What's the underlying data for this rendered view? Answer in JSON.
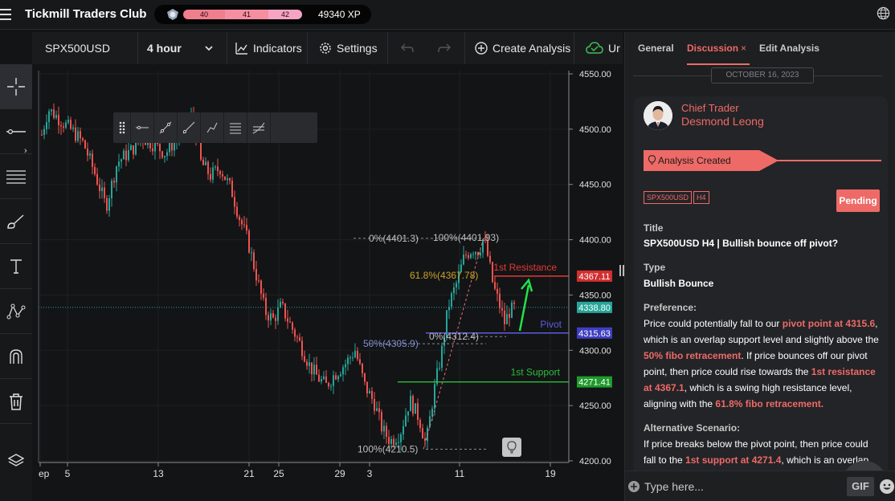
{
  "app": {
    "brand": "Tickmill Traders Club"
  },
  "xp": {
    "levels": [
      "40",
      "41",
      "42"
    ],
    "progress": 0.88,
    "total": "49340 XP"
  },
  "toolbar": {
    "symbol": "SPX500USD",
    "interval": "4 hour",
    "indicators": "Indicators",
    "settings": "Settings",
    "create_analysis": "Create Analysis",
    "extra": "Ur"
  },
  "chart": {
    "y_ticks": [
      "4550.00",
      "4500.00",
      "4450.00",
      "4400.00",
      "4350.00",
      "4300.00",
      "4250.00",
      "4200.00"
    ],
    "x_ticks": [
      "ep",
      "5",
      "13",
      "21",
      "25",
      "29",
      "3",
      "11",
      "19"
    ],
    "fib_labels": {
      "top_left": "0%(4401.3)",
      "top_right": "100%(4401.93)",
      "fib618": "61.8%(4367.78)",
      "fib50": "50%(4305.9)",
      "fib0": "0%(4312.4)",
      "fib100": "100%(4210.5)"
    },
    "levels": {
      "resistance_label": "1st Resistance",
      "resistance_value": "4367.11",
      "current_value": "4338.80",
      "pivot_label": "Pivot",
      "pivot_value": "4315.63",
      "support_label": "1st Support",
      "support_value": "4271.41"
    },
    "colors": {
      "up": "#26a69a",
      "down": "#ef5350",
      "resistance": "#e53935",
      "pivot": "#5c5ce0",
      "support": "#2bbf3a",
      "current": "#26a69a"
    }
  },
  "panel": {
    "tabs": [
      "General",
      "Discussion",
      "Edit Analysis"
    ],
    "date": "OCTOBER 16, 2023",
    "role": "Chief Trader",
    "author": "Desmond Leong",
    "banner": "Analysis Created",
    "tags": [
      "SPX500USD",
      "H4"
    ],
    "status": "Pending",
    "title_label": "Title",
    "title_value": "SPX500USD H4 | Bullish bounce off pivot?",
    "type_label": "Type",
    "type_value": "Bullish Bounce",
    "preference_label": "Preference:",
    "preference": {
      "t1": "Price could potentially fall to our ",
      "h1": "pivot point at 4315.6",
      "t2": ", which is an overlap support level and slightly above the ",
      "h2": "50% fibo retracement",
      "t3": ". If price bounces off our pivot point, then price could rise towards the ",
      "h3": "1st resistance at 4367.1",
      "t4": ", which is a swing high resistance level, aligning with the ",
      "h4": "61.8% fibo retracement.",
      "t5": ""
    },
    "alt_label": "Alternative Scenario:",
    "alternative": {
      "t1": "If price breaks below the pivot point, then price could fall to the ",
      "h1": "1st support at 4271.4",
      "t2": ", which is an overlap"
    },
    "composer_placeholder": "Type here...",
    "gif": "GIF"
  }
}
